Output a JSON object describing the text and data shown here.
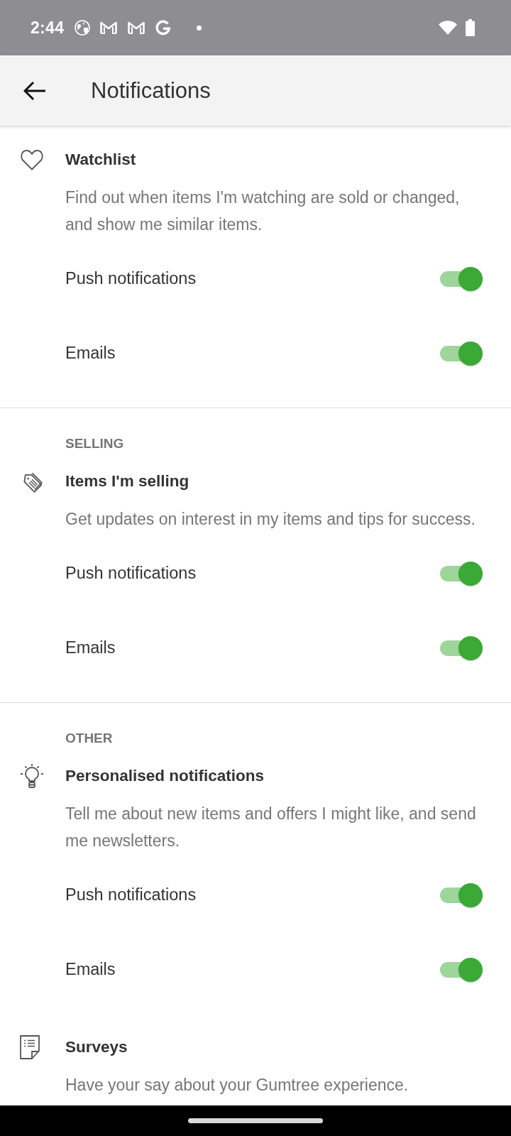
{
  "status_bar": {
    "time": "2:44"
  },
  "app_bar": {
    "title": "Notifications"
  },
  "sections": [
    {
      "groups": [
        {
          "title": "Watchlist",
          "description": "Find out when items I'm watching are sold or changed, and show me similar items.",
          "toggles": [
            {
              "label": "Push notifications",
              "on": true
            },
            {
              "label": "Emails",
              "on": true
            }
          ]
        }
      ]
    },
    {
      "heading": "SELLING",
      "groups": [
        {
          "title": "Items I'm selling",
          "description": "Get updates on interest in my items and tips for success.",
          "toggles": [
            {
              "label": "Push notifications",
              "on": true
            },
            {
              "label": "Emails",
              "on": true
            }
          ]
        }
      ]
    },
    {
      "heading": "OTHER",
      "groups": [
        {
          "title": "Personalised notifications",
          "description": "Tell me about new items and offers I might like, and send me newsletters.",
          "toggles": [
            {
              "label": "Push notifications",
              "on": true
            },
            {
              "label": "Emails",
              "on": true
            }
          ]
        },
        {
          "title": "Surveys",
          "description": "Have your say about your Gumtree experience."
        }
      ]
    }
  ]
}
